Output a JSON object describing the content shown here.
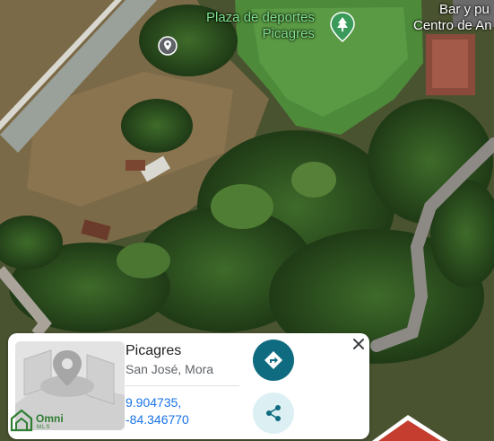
{
  "map": {
    "labels": {
      "park_line1": "Plaza de deportes",
      "park_line2": "Picagres",
      "business_line1": "Bar y pu",
      "business_line2": "Centro de An"
    }
  },
  "card": {
    "title": "Picagres",
    "subtitle": "San José, Mora",
    "latitude": "9.904735,",
    "longitude": "-84.346770",
    "logo_text": "Omni",
    "logo_sub": "MLS"
  },
  "colors": {
    "accent": "#0f6b80",
    "share_bg": "#dcf0f4",
    "coords": "#1a73e8",
    "park_label": "#7ee08b"
  },
  "icons": {
    "park_pin": "tree-pin-icon",
    "location_pin": "location-pin-icon",
    "directions": "directions-icon",
    "share": "share-icon",
    "close": "close-icon"
  }
}
